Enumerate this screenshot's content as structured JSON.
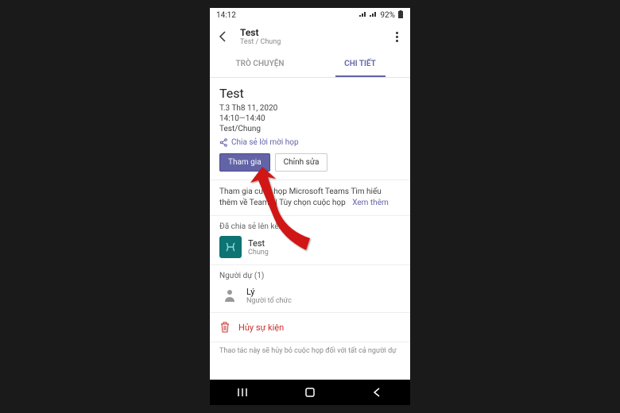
{
  "statusbar": {
    "time": "14:12",
    "battery": "92%"
  },
  "header": {
    "title": "Test",
    "subtitle": "Test / Chung"
  },
  "tabs": {
    "chat": "TRÒ CHUYỆN",
    "details": "CHI TIẾT"
  },
  "meeting": {
    "title": "Test",
    "date": "T.3 Th8 11, 2020",
    "time": "14:10—14:40",
    "channel": "Test/Chung",
    "share_label": "Chia sẻ lời mời họp",
    "join_label": "Tham gia",
    "edit_label": "Chỉnh sửa"
  },
  "info": {
    "text": "Tham gia cuộc họp Microsoft Teams Tìm hiểu thêm về Teams | Tùy chọn cuộc họp",
    "see_more": "Xem thêm"
  },
  "shared": {
    "section_label": "Đã chia sẻ lên kênh",
    "channel_name": "Test",
    "channel_sub": "Chung"
  },
  "attendees": {
    "section_label": "Người dự (1)",
    "name": "Lý",
    "role": "Người tổ chức"
  },
  "cancel": {
    "label": "Hủy sự kiện"
  },
  "footer_note": "Thao tác này sẽ hủy bỏ cuộc họp đối với tất cả người dự",
  "colors": {
    "accent": "#6264A7",
    "danger": "#c9302c"
  }
}
